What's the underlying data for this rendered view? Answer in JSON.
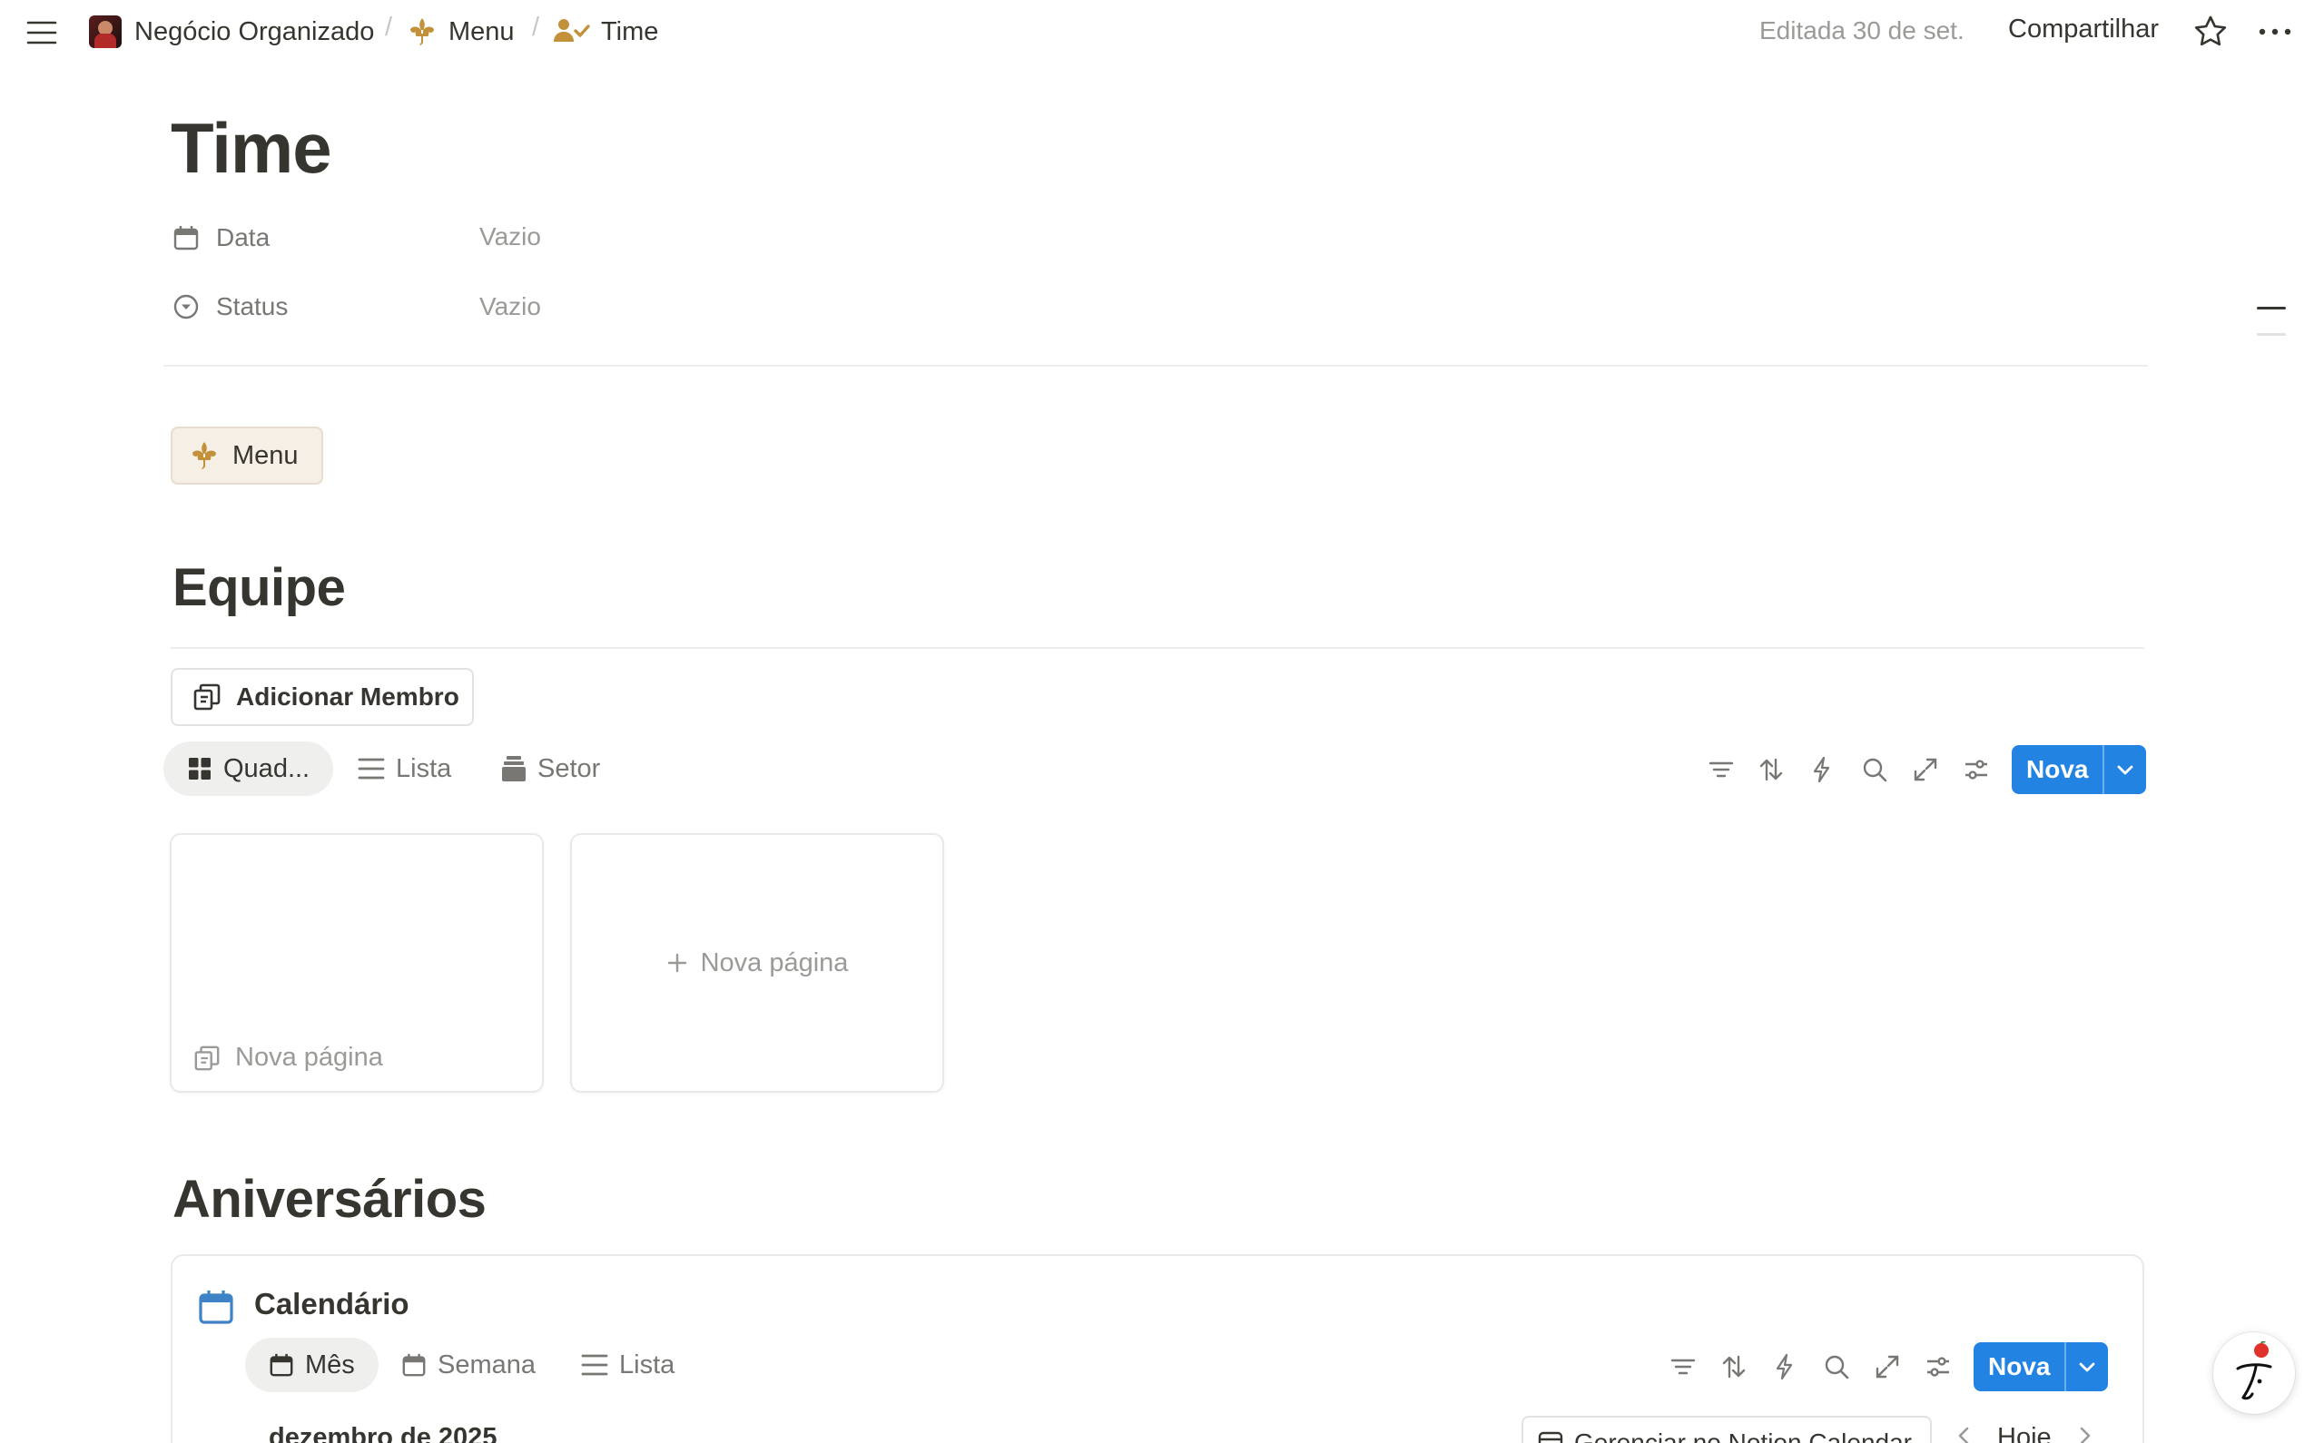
{
  "breadcrumb": {
    "workspace": "Negócio Organizado",
    "menu": "Menu",
    "page": "Time",
    "separator": "/"
  },
  "topbar": {
    "edited": "Editada 30 de set.",
    "share": "Compartilhar"
  },
  "page": {
    "title": "Time",
    "properties": [
      {
        "label": "Data",
        "value": "Vazio",
        "icon": "calendar-icon"
      },
      {
        "label": "Status",
        "value": "Vazio",
        "icon": "status-icon"
      }
    ]
  },
  "menu_link": {
    "label": "Menu",
    "icon": "fleur-de-lis-icon"
  },
  "team": {
    "heading": "Equipe",
    "add_button": "Adicionar Membro",
    "views": [
      {
        "label": "Quad...",
        "icon": "grid-icon",
        "active": true
      },
      {
        "label": "Lista",
        "icon": "list-icon",
        "active": false
      },
      {
        "label": "Setor",
        "icon": "stack-icon",
        "active": false
      }
    ],
    "new_button": "Nova",
    "card_empty": "Nova página",
    "card_add": "Nova página"
  },
  "birthdays": {
    "heading": "Aniversários",
    "calendar_title": "Calendário",
    "views": [
      {
        "label": "Mês",
        "icon": "calendar-icon",
        "active": true
      },
      {
        "label": "Semana",
        "icon": "calendar-icon",
        "active": false
      },
      {
        "label": "Lista",
        "icon": "list-icon",
        "active": false
      }
    ],
    "new_button": "Nova",
    "month": "dezembro de 2025",
    "manage_button": "Gerenciar no Notion Calendar",
    "today": "Hoje"
  },
  "colors": {
    "accent": "#2383e2",
    "text": "#37352f",
    "muted": "#9b9a97",
    "menu_bg": "#f6efe6",
    "calendar_icon": "#3f83c7"
  }
}
